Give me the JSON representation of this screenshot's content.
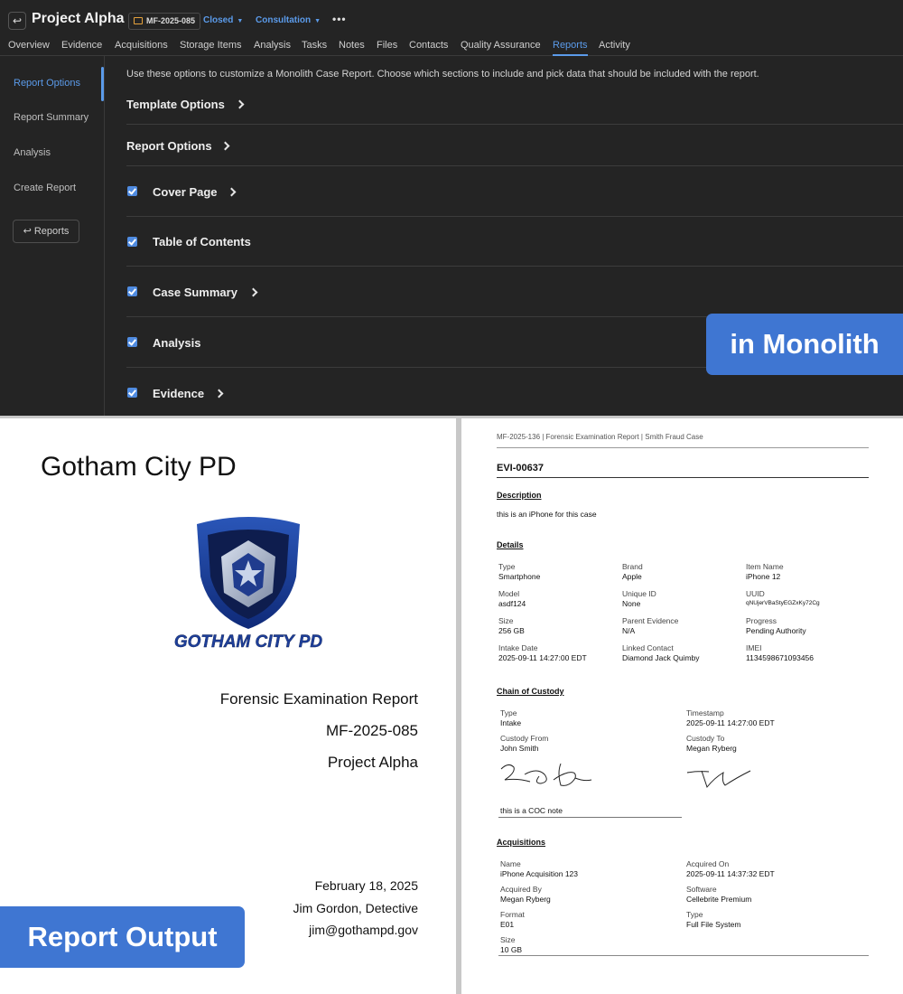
{
  "app": {
    "project_title": "Project Alpha",
    "case_number": "MF-2025-085",
    "status": "Closed",
    "case_type": "Consultation",
    "more": "•••",
    "back_glyph": "↩",
    "tabs": [
      "Overview",
      "Evidence",
      "Acquisitions",
      "Storage Items",
      "Analysis",
      "Tasks",
      "Notes",
      "Files",
      "Contacts",
      "Quality Assurance",
      "Reports",
      "Activity"
    ],
    "active_tab": "Reports",
    "sidebar": {
      "items": [
        "Report Options",
        "Report Summary",
        "Analysis",
        "Create Report"
      ],
      "active": "Report Options",
      "back_button": "↩  Reports"
    },
    "intro": "Use these options to customize a Monolith Case Report. Choose which sections to include and pick data that should be included with the report.",
    "options": [
      {
        "label": "Template Options",
        "checkbox": false,
        "checked": false,
        "expandable": true
      },
      {
        "label": "Report Options",
        "checkbox": false,
        "checked": false,
        "expandable": true
      },
      {
        "label": "Cover Page",
        "checkbox": true,
        "checked": true,
        "expandable": true
      },
      {
        "label": "Table of Contents",
        "checkbox": true,
        "checked": true,
        "expandable": false
      },
      {
        "label": "Case Summary",
        "checkbox": true,
        "checked": true,
        "expandable": true
      },
      {
        "label": "Analysis",
        "checkbox": true,
        "checked": true,
        "expandable": false
      },
      {
        "label": "Evidence",
        "checkbox": true,
        "checked": true,
        "expandable": true
      }
    ]
  },
  "badges": {
    "monolith": "in Monolith",
    "output": "Report Output"
  },
  "cover": {
    "agency": "Gotham City PD",
    "logo_text": "GOTHAM CITY PD",
    "report_title": "Forensic Examination Report",
    "case_number": "MF-2025-085",
    "project": "Project Alpha",
    "date": "February 18, 2025",
    "examiner": "Jim Gordon, Detective",
    "email": "jim@gothampd.gov"
  },
  "report": {
    "running_header": "MF-2025-136 | Forensic Examination Report | Smith Fraud Case",
    "evidence_id": "EVI-00637",
    "description_heading": "Description",
    "description": "this is an iPhone for this case",
    "details_heading": "Details",
    "details": [
      {
        "label": "Type",
        "value": "Smartphone"
      },
      {
        "label": "Brand",
        "value": "Apple"
      },
      {
        "label": "Item Name",
        "value": "iPhone 12"
      },
      {
        "label": "Model",
        "value": "asdf124"
      },
      {
        "label": "Unique ID",
        "value": "None"
      },
      {
        "label": "UUID",
        "value": "qNUjerVBaStyEGZxKy72Cg"
      },
      {
        "label": "Size",
        "value": "256 GB"
      },
      {
        "label": "Parent Evidence",
        "value": "N/A"
      },
      {
        "label": "Progress",
        "value": "Pending Authority"
      },
      {
        "label": "Intake Date",
        "value": "2025-09-11 14:27:00 EDT"
      },
      {
        "label": "Linked Contact",
        "value": "Diamond Jack Quimby"
      },
      {
        "label": "IMEI",
        "value": "1134598671093456"
      }
    ],
    "coc_heading": "Chain of Custody",
    "coc": [
      {
        "label": "Type",
        "value": "Intake"
      },
      {
        "label": "Timestamp",
        "value": "2025-09-11 14:27:00 EDT"
      },
      {
        "label": "Custody From",
        "value": "John Smith"
      },
      {
        "label": "Custody To",
        "value": "Megan Ryberg"
      }
    ],
    "coc_note": "this is a COC note",
    "acq_heading": "Acquisitions",
    "acquisitions": [
      {
        "label": "Name",
        "value": "iPhone Acquisition 123"
      },
      {
        "label": "Acquired On",
        "value": "2025-09-11 14:37:32 EDT"
      },
      {
        "label": "Acquired By",
        "value": "Megan Ryberg"
      },
      {
        "label": "Software",
        "value": "Cellebrite Premium"
      },
      {
        "label": "Format",
        "value": "E01"
      },
      {
        "label": "Type",
        "value": "Full File System"
      },
      {
        "label": "Size",
        "value": "10 GB"
      }
    ]
  },
  "colors": {
    "accent": "#5b9bea",
    "badge": "#3f76d2",
    "app_bg": "#242424"
  }
}
